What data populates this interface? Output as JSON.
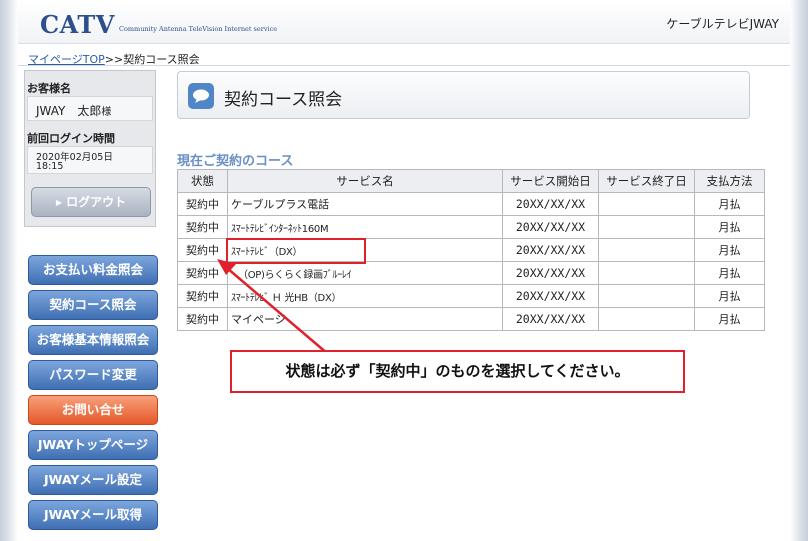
{
  "header": {
    "logo": "CATV",
    "logo_sub": "Community Antenna TeleVision Internet service",
    "company": "ケーブルテレビJWAY"
  },
  "breadcrumb": {
    "home": "マイページTOP",
    "separator": ">>",
    "current": "契約コース照会"
  },
  "customer_panel": {
    "name_label": "お客様名",
    "name": "JWAY　太郎",
    "honorific": "様",
    "last_login_label": "前回ログイン時間",
    "last_login_date": "2020年02月05日",
    "last_login_time": "18:15",
    "logout_label": "ログアウト"
  },
  "nav": [
    {
      "label": "お支払い料金照会"
    },
    {
      "label": "契約コース照会"
    },
    {
      "label": "お客様基本情報照会"
    },
    {
      "label": "パスワード変更"
    },
    {
      "label": "お問い合せ"
    },
    {
      "label": "JWAYトップページ"
    },
    {
      "label": "JWAYメール設定"
    },
    {
      "label": "JWAYメール取得"
    }
  ],
  "main": {
    "title": "契約コース照会",
    "section_title": "現在ご契約のコース",
    "table": {
      "headers": [
        "状態",
        "サービス名",
        "サービス開始日",
        "サービス終了日",
        "支払方法"
      ],
      "rows": [
        {
          "status": "契約中",
          "service": "ケーブルプラス電話",
          "start": "20XX/XX/XX",
          "end": "",
          "payment": "月払"
        },
        {
          "status": "契約中",
          "service": "ｽﾏｰﾄﾃﾚﾋﾞｲﾝﾀｰﾈｯﾄ160M",
          "start": "20XX/XX/XX",
          "end": "",
          "payment": "月払"
        },
        {
          "status": "契約中",
          "service": "ｽﾏｰﾄﾃﾚﾋﾞ（DX）",
          "start": "20XX/XX/XX",
          "end": "",
          "payment": "月払"
        },
        {
          "status": "契約中",
          "service": "（OP)らくらく録画ﾌﾞﾙｰﾚｲ",
          "start": "20XX/XX/XX",
          "end": "",
          "payment": "月払"
        },
        {
          "status": "契約中",
          "service": "ｽﾏｰﾄﾃﾚﾋﾞ Ｈ 光HB（DX）",
          "start": "20XX/XX/XX",
          "end": "",
          "payment": "月払"
        },
        {
          "status": "契約中",
          "service": "マイページ",
          "start": "20XX/XX/XX",
          "end": "",
          "payment": "月払"
        }
      ]
    }
  },
  "annotation": {
    "callout": "状態は必ず「契約中」のものを選択してください。"
  },
  "colors": {
    "nav_blue": "#4a78bb",
    "nav_orange": "#ee6a38",
    "annotation_red": "#e0202a",
    "section_title": "#6a8fc4"
  }
}
